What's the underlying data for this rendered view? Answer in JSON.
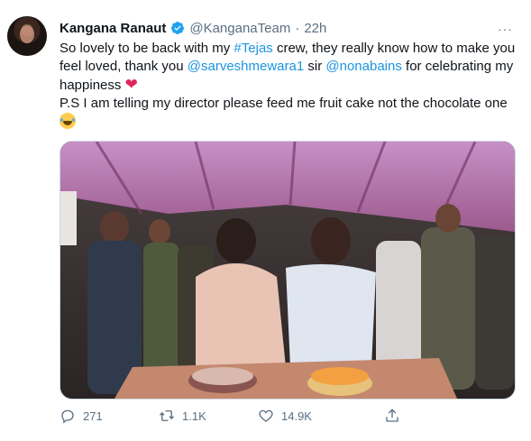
{
  "tweet": {
    "author_name": "Kangana Ranaut",
    "handle": "@KanganaTeam",
    "separator": "·",
    "time": "22h",
    "more_label": "···",
    "line1_prefix": "So lovely to be back with my ",
    "hashtag": "#Tejas",
    "line1_mid": " crew, they really know how to make you feel loved, thank you ",
    "mention1": "@sarveshmewara1",
    "line1_mid2": " sir ",
    "mention2": "@nonabains",
    "line1_suffix": " for celebrating my happiness ",
    "heart": "❤",
    "line2": "P.S I am telling my director please feed me fruit cake not the chocolate one",
    "media_icon": "photo",
    "actions": {
      "reply_count": "271",
      "retweet_count": "1.1K",
      "like_count": "14.9K"
    }
  },
  "colors": {
    "link": "#1b95e0",
    "muted": "#5b7083",
    "heart": "#e0245e"
  }
}
